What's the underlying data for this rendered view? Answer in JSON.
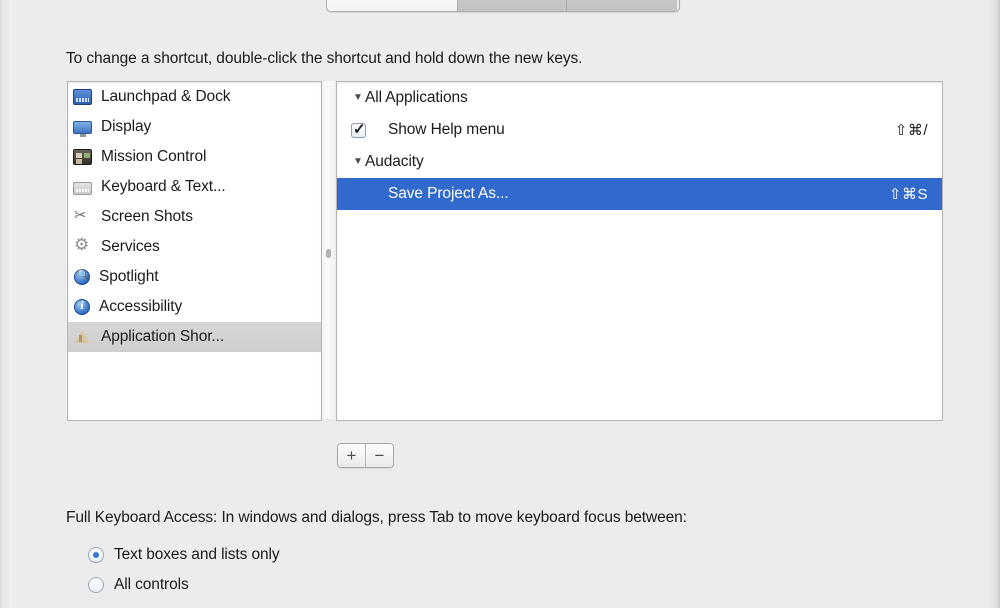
{
  "window": {
    "background_color": "#ececec"
  },
  "tabbar": {
    "tabs": [
      {
        "label": "",
        "selected": true
      },
      {
        "label": "",
        "selected": false
      },
      {
        "label": "",
        "selected": false
      }
    ]
  },
  "instruction": {
    "text": "To change a shortcut, double-click the shortcut and hold down the new keys."
  },
  "sidebar": {
    "selected_index": 8,
    "items": [
      {
        "label": "Launchpad & Dock",
        "icon": "launchpad-dock-icon",
        "icon_class": "ic-dock"
      },
      {
        "label": "Display",
        "icon": "display-icon",
        "icon_class": "ic-display"
      },
      {
        "label": "Mission Control",
        "icon": "mission-control-icon",
        "icon_class": "ic-mission"
      },
      {
        "label": "Keyboard & Text...",
        "icon": "keyboard-text-icon",
        "icon_class": "ic-keyboard"
      },
      {
        "label": "Screen Shots",
        "icon": "screen-shots-icon",
        "icon_class": "ic-shots"
      },
      {
        "label": "Services",
        "icon": "services-gear-icon",
        "icon_class": "ic-services"
      },
      {
        "label": "Spotlight",
        "icon": "spotlight-search-icon",
        "icon_class": "ic-spotlight"
      },
      {
        "label": "Accessibility",
        "icon": "accessibility-info-icon",
        "icon_class": "ic-access"
      },
      {
        "label": "Application Shor...",
        "icon": "application-shortcuts-icon",
        "icon_class": "ic-appshort"
      }
    ]
  },
  "shortcuts": {
    "selection_color": "#3269cc",
    "rows": [
      {
        "type": "group",
        "label": "All Applications",
        "disclosure": "▼",
        "expanded": true,
        "shortcut": "",
        "checked": null,
        "selected": false
      },
      {
        "type": "item",
        "label": "Show Help menu",
        "disclosure": "",
        "expanded": null,
        "shortcut": "⇧⌘/",
        "checked": true,
        "selected": false
      },
      {
        "type": "group",
        "label": "Audacity",
        "disclosure": "▼",
        "expanded": true,
        "shortcut": "",
        "checked": null,
        "selected": false
      },
      {
        "type": "item",
        "label": "Save Project As...",
        "disclosure": "",
        "expanded": null,
        "shortcut": "⇧⌘S",
        "checked": false,
        "selected": true
      }
    ]
  },
  "list_controls": {
    "add_label": "+",
    "remove_label": "−"
  },
  "full_keyboard_access": {
    "text": "Full Keyboard Access: In windows and dialogs, press Tab to move keyboard focus between:",
    "selected_index": 0,
    "options": [
      {
        "label": "Text boxes and lists only"
      },
      {
        "label": "All controls"
      }
    ]
  }
}
